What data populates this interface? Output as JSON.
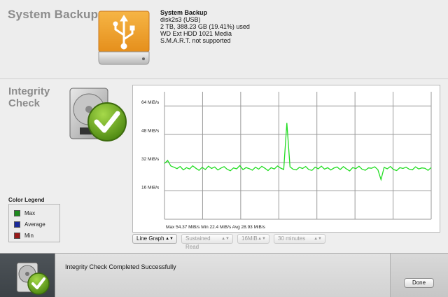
{
  "device": {
    "title": "System Backup",
    "name": "System Backup",
    "identifier": "disk2s3 (USB)",
    "usage": "2 TB, 388.23 GB (19.41%) used",
    "model": "WD Ext HDD 1021 Media",
    "smart": "S.M.A.R.T. not supported",
    "icon": "usb-drive-icon",
    "icon_color": "#f0a030"
  },
  "integrity": {
    "title_line1": "Integrity",
    "title_line2": "Check",
    "icon": "hard-drive-check-icon",
    "check_color": "#79b52b"
  },
  "legend": {
    "title": "Color Legend",
    "items": [
      {
        "label": "Max",
        "color": "#1e8a1e"
      },
      {
        "label": "Average",
        "color": "#1a2a9a"
      },
      {
        "label": "Min",
        "color": "#9a1a1a"
      }
    ]
  },
  "controls": {
    "graph_type": "Line Graph",
    "test_type": "Sustained Read",
    "block_size": "16MiB",
    "duration": "30 minutes"
  },
  "chart_data": {
    "type": "line",
    "title": "",
    "xlabel": "",
    "ylabel": "",
    "y_unit": "MiB/s",
    "ylim": [
      0,
      72
    ],
    "yticks": [
      16,
      32,
      48,
      64
    ],
    "ytick_labels": [
      "16 MiB/s",
      "32 MiB/s",
      "48 MiB/s",
      "64 MiB/s"
    ],
    "grid": true,
    "line_color": "#22dd22",
    "summary": "Max 54.37 MiB/s  Min 22.4 MiB/s  Avg 28.93 MiB/s",
    "series": [
      {
        "values": [
          31.5,
          33.2,
          30.1,
          29.4,
          28.6,
          29.8,
          27.9,
          29.1,
          28.4,
          30.2,
          28.8,
          27.6,
          29.3,
          28.1,
          30.0,
          28.7,
          29.5,
          27.8,
          28.9,
          29.7,
          28.2,
          27.4,
          29.0,
          28.5,
          30.3,
          28.0,
          29.2,
          28.6,
          27.7,
          29.4,
          28.3,
          29.9,
          28.8,
          27.5,
          29.1,
          28.4,
          30.1,
          28.9,
          28.1,
          54.37,
          29.6,
          28.2,
          27.9,
          29.3,
          28.7,
          29.8,
          28.0,
          27.6,
          29.4,
          28.5,
          30.0,
          28.3,
          29.1,
          27.8,
          28.9,
          29.5,
          28.1,
          29.7,
          28.4,
          27.3,
          29.2,
          28.6,
          29.9,
          28.2,
          27.7,
          29.0,
          28.8,
          29.6,
          28.0,
          22.4,
          29.3,
          28.5,
          29.8,
          28.1,
          27.5,
          29.1,
          28.7,
          29.4,
          28.3,
          27.9,
          29.6,
          28.4,
          29.0,
          28.8,
          27.6,
          29.2
        ]
      }
    ]
  },
  "status": {
    "message": "Integrity Check Completed Successfully",
    "done_label": "Done"
  }
}
